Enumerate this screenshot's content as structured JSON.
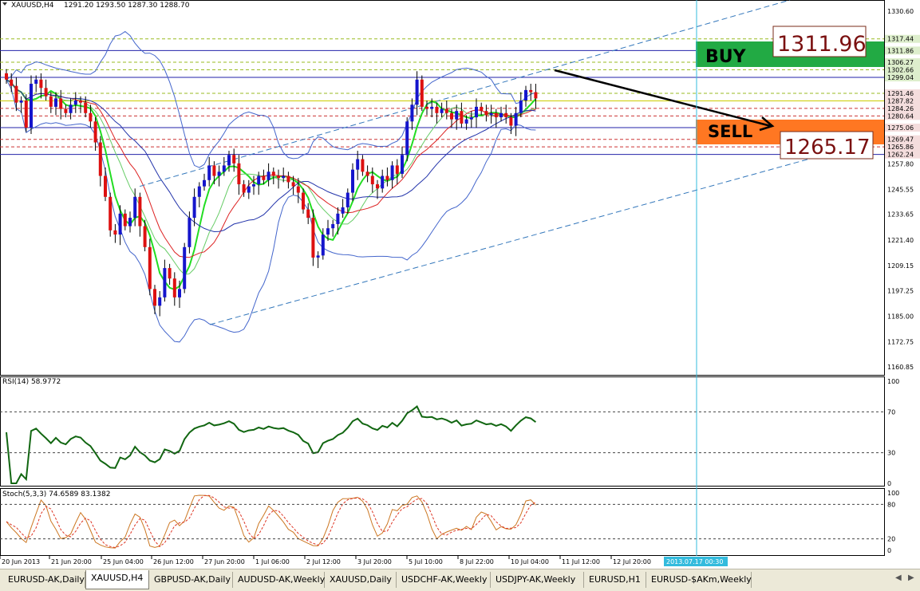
{
  "window": {
    "symbol_header": "XAUUSD,H4",
    "ohlc_header": "1291.20 1293.50 1287.30 1288.70"
  },
  "indicators": {
    "rsi_label": "RSI(14) 58.9772",
    "stoch_label": "Stoch(5,3,3) 74.6589 83.1382",
    "rsi_ticks": [
      "100",
      "70",
      "30",
      "0"
    ],
    "stoch_ticks": [
      "100",
      "80",
      "20",
      "0"
    ]
  },
  "annotations": {
    "buy_label": "BUY",
    "buy_price": "1311.96",
    "sell_label": "SELL",
    "sell_price": "1265.17"
  },
  "time_axis": {
    "labels": [
      "20 Jun 2013",
      "21 Jun 20:00",
      "25 Jun 04:00",
      "26 Jun 12:00",
      "27 Jun 20:00",
      "1 Jul 06:00",
      "2 Jul 12:00",
      "3 Jul 20:00",
      "5 Jul 10:00",
      "8 Jul 22:00",
      "10 Jul 04:00",
      "11 Jul 12:00",
      "12 Jul 20:00"
    ],
    "cursor_label": "2013.07.17 00:30"
  },
  "tabs": [
    {
      "label": "EURUSD-AK,Daily"
    },
    {
      "label": "XAUUSD,H4"
    },
    {
      "label": "GBPUSD-AK,Daily"
    },
    {
      "label": "AUDUSD-AK,Weekly"
    },
    {
      "label": "XAUUSD,Daily"
    },
    {
      "label": "USDCHF-AK,Weekly"
    },
    {
      "label": "USDJPY-AK,Weekly"
    },
    {
      "label": "EURUSD,H1"
    },
    {
      "label": "EURUSD-$AKm,Weekly"
    }
  ],
  "colors": {
    "bull": "#1515cc",
    "bear": "#dd1010",
    "ma_green": "#22dd22",
    "buy_bg": "#22aa44",
    "sell_bg": "#ff7722",
    "rsi": "#116611",
    "stoch_main": "#cc7722",
    "stoch_signal": "#dd3322"
  },
  "chart_data": [
    {
      "type": "candlestick",
      "title": "XAUUSD,H4",
      "price_ticks": [
        "1330.60",
        "1317.44",
        "1311.86",
        "1306.27",
        "1302.66",
        "1299.04",
        "1291.46",
        "1287.82",
        "1284.26",
        "1280.64",
        "1275.06",
        "1269.47",
        "1265.86",
        "1262.24",
        "1257.80",
        "1245.55",
        "1233.65",
        "1221.40",
        "1209.15",
        "1197.25",
        "1185.00",
        "1172.75",
        "1160.85"
      ],
      "ylim": [
        1157,
        1336
      ],
      "levels": [
        {
          "price": 1317.44,
          "color": "#99bb22",
          "style": "dash"
        },
        {
          "price": 1311.86,
          "color": "#2222aa",
          "style": "solid"
        },
        {
          "price": 1306.27,
          "color": "#99bb22",
          "style": "dash"
        },
        {
          "price": 1302.66,
          "color": "#99bb22",
          "style": "dash"
        },
        {
          "price": 1299.04,
          "color": "#2222aa",
          "style": "solid"
        },
        {
          "price": 1291.46,
          "color": "#99bb22",
          "style": "dash"
        },
        {
          "price": 1287.82,
          "color": "#cccc00",
          "style": "solid"
        },
        {
          "price": 1284.26,
          "color": "#cc3333",
          "style": "dash"
        },
        {
          "price": 1280.64,
          "color": "#cc3333",
          "style": "dash"
        },
        {
          "price": 1275.06,
          "color": "#2222aa",
          "style": "solid"
        },
        {
          "price": 1269.47,
          "color": "#cc3333",
          "style": "dash"
        },
        {
          "price": 1265.86,
          "color": "#cc3333",
          "style": "dash"
        },
        {
          "price": 1262.24,
          "color": "#2222aa",
          "style": "solid"
        }
      ],
      "closes": [
        1298,
        1295,
        1287,
        1288,
        1275,
        1296,
        1298,
        1294,
        1290,
        1285,
        1289,
        1284,
        1282,
        1286,
        1288,
        1287,
        1282,
        1278,
        1268,
        1252,
        1242,
        1226,
        1224,
        1234,
        1228,
        1232,
        1242,
        1228,
        1218,
        1198,
        1190,
        1194,
        1208,
        1203,
        1194,
        1198,
        1218,
        1232,
        1242,
        1247,
        1250,
        1257,
        1252,
        1254,
        1257,
        1262,
        1258,
        1248,
        1244,
        1247,
        1248,
        1252,
        1250,
        1254,
        1252,
        1251,
        1252,
        1249,
        1247,
        1244,
        1236,
        1232,
        1213,
        1214,
        1224,
        1227,
        1229,
        1234,
        1237,
        1244,
        1255,
        1260,
        1254,
        1252,
        1248,
        1246,
        1252,
        1250,
        1257,
        1253,
        1262,
        1278,
        1286,
        1298,
        1285,
        1284,
        1285,
        1282,
        1284,
        1282,
        1279,
        1283,
        1277,
        1279,
        1280,
        1285,
        1283,
        1281,
        1282,
        1280,
        1282,
        1280,
        1276,
        1282,
        1288,
        1293,
        1292,
        1289
      ],
      "series": [
        {
          "name": "RSI(14)",
          "last": 58.9772
        },
        {
          "name": "Stoch(5,3,3)",
          "values": [
            74.6589,
            83.1382
          ]
        }
      ]
    }
  ]
}
